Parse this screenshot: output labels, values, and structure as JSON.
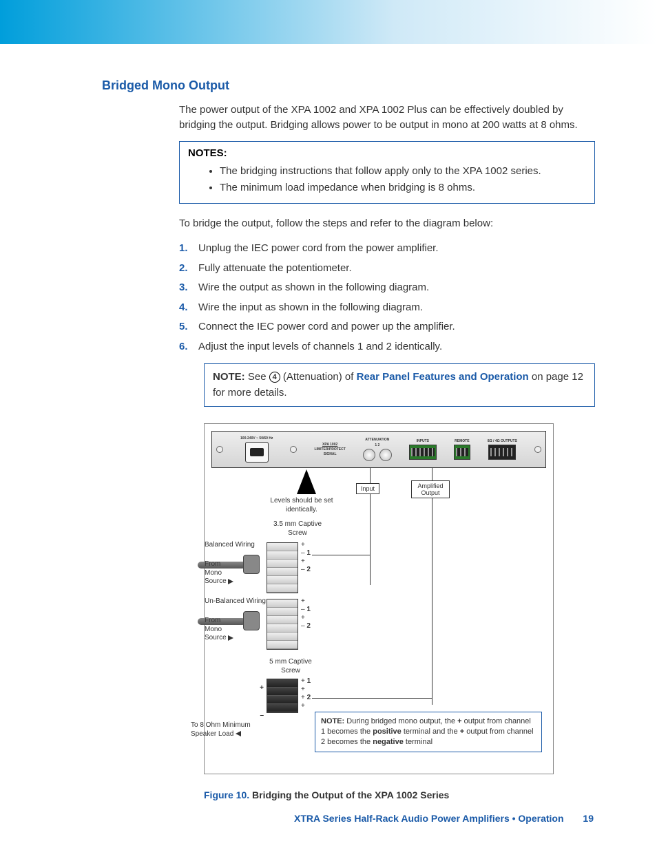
{
  "heading": "Bridged Mono Output",
  "intro": "The power output of the XPA 1002 and XPA 1002 Plus can be effectively doubled by bridging the output. Bridging allows power to be output in mono at 200 watts at 8 ohms.",
  "notes_box": {
    "title": "NOTES:",
    "items": [
      "The bridging instructions that follow apply only to the XPA 1002 series.",
      "The minimum load impedance when bridging is 8 ohms."
    ]
  },
  "bridge_intro": "To bridge the output, follow the steps and refer to the diagram below:",
  "steps": [
    "Unplug the IEC power cord from the power amplifier.",
    "Fully attenuate the potentiometer.",
    "Wire the output as shown in the following diagram.",
    "Wire the input as shown in the following diagram.",
    "Connect the IEC power cord and power up the amplifier.",
    "Adjust the input levels of channels 1 and 2 identically."
  ],
  "note_inline": {
    "label": "NOTE:",
    "prefix": "See ",
    "circled": "4",
    "mid": " (Attenuation) of ",
    "link": "Rear Panel Features and Operation",
    "suffix": " on page 12 for more details."
  },
  "diagram": {
    "panel": {
      "power_spec": "100-240V ~ 50/60 Hz",
      "model": "XPA 1002",
      "limiter": "LIMITER/PROTECT",
      "signal": "SIGNAL",
      "attenuation": "ATTENUATION",
      "inputs_hdr": "INPUTS",
      "remote_hdr": "REMOTE",
      "outputs_hdr": "8Ω / 4Ω OUTPUTS",
      "ch_labels": "1    2"
    },
    "levels_note": "Levels should be set identically.",
    "input_box": "Input",
    "output_box": "Amplified Output",
    "captive_35": "3.5 mm Captive Screw",
    "balanced": "Balanced Wiring",
    "unbalanced": "Un-Balanced Wiring",
    "from_mono": "From Mono Source",
    "captive_5": "5 mm Captive Screw",
    "speaker_load": "To 8 Ohm Minimum Speaker Load",
    "term_marks": {
      "plus": "+",
      "minus": "–",
      "one": "1",
      "two": "2"
    },
    "note_box": {
      "label": "NOTE:",
      "text_a": "During bridged mono output, the ",
      "plus": "+",
      "text_b": " output from channel 1 becomes the ",
      "positive": "positive",
      "text_c": " terminal and the ",
      "text_d": " output from channel 2 becomes the ",
      "negative": "negative",
      "text_e": " terminal"
    }
  },
  "figure": {
    "num": "Figure 10.",
    "title": "Bridging the Output of the XPA 1002 Series"
  },
  "footer": {
    "doc": "XTRA Series Half-Rack Audio Power Amplifiers • Operation",
    "page": "19"
  }
}
